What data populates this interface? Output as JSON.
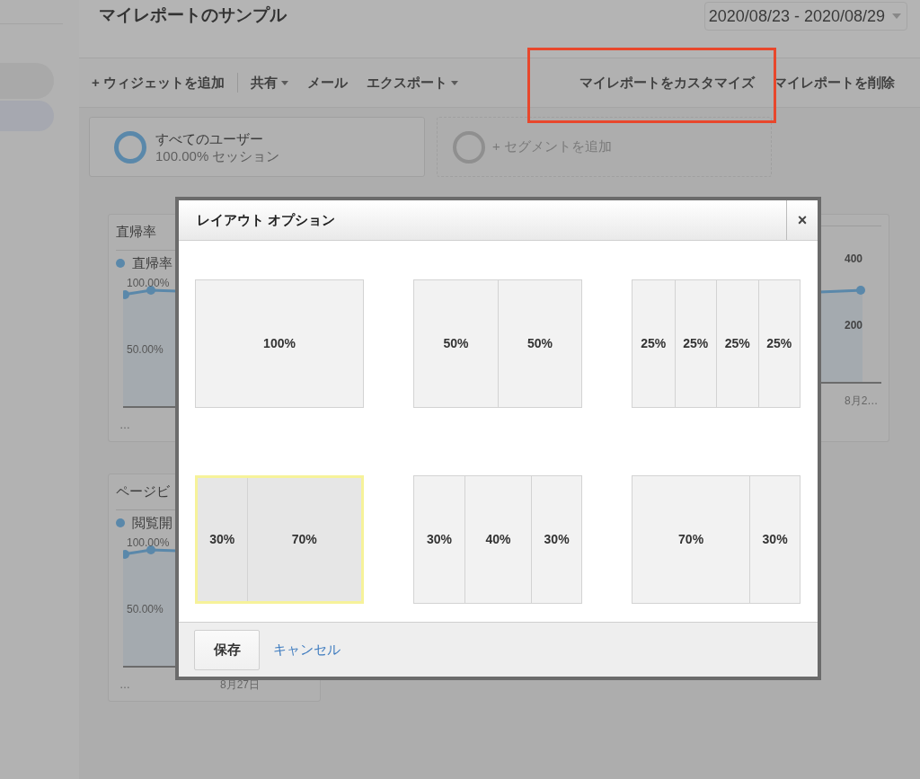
{
  "header": {
    "title": "マイレポートのサンプル",
    "date_range": "2020/08/23 - 2020/08/29"
  },
  "toolbar": {
    "left": [
      {
        "label": "+ ウィジェットを追加",
        "dropdown": false
      },
      {
        "label": "共有",
        "dropdown": true
      },
      {
        "label": "メール",
        "dropdown": false
      },
      {
        "label": "エクスポート",
        "dropdown": true
      }
    ],
    "right": [
      {
        "label": "マイレポートをカスタマイズ",
        "dropdown": false
      },
      {
        "label": "マイレポートを削除",
        "dropdown": false
      }
    ]
  },
  "segments": [
    {
      "kind": "active",
      "name": "すべてのユーザー",
      "detail": "100.00% セッション"
    },
    {
      "kind": "add",
      "name": "+ セグメントを追加"
    }
  ],
  "widgets": [
    {
      "title": "直帰率",
      "legend": "直帰率",
      "yticks": [
        "100.00%",
        "50.00%"
      ],
      "footer": "…"
    },
    {
      "yticks": [
        "400",
        "200"
      ],
      "xlabel": "8月2…"
    },
    {
      "title": "ページビ",
      "legend": "閲覧開",
      "yticks": [
        "100.00%",
        "50.00%"
      ],
      "footer": "…",
      "xlabel": "8月27日"
    }
  ],
  "dialog": {
    "title": "レイアウト オプション",
    "close": "×",
    "options": [
      {
        "kind": "full",
        "cells": [
          "100%"
        ],
        "selected": false
      },
      {
        "kind": "halves",
        "cells": [
          "50%",
          "50%"
        ],
        "selected": false
      },
      {
        "kind": "quarters",
        "cells": [
          "25%",
          "25%",
          "25%",
          "25%"
        ],
        "selected": false
      },
      {
        "kind": "narrow-wide",
        "cells": [
          "30%",
          "70%"
        ],
        "selected": true
      },
      {
        "kind": "three",
        "cells": [
          "30%",
          "40%",
          "30%"
        ],
        "selected": false
      },
      {
        "kind": "wide-narrow",
        "cells": [
          "70%",
          "30%"
        ],
        "selected": false
      }
    ],
    "save": "保存",
    "cancel": "キャンセル"
  }
}
